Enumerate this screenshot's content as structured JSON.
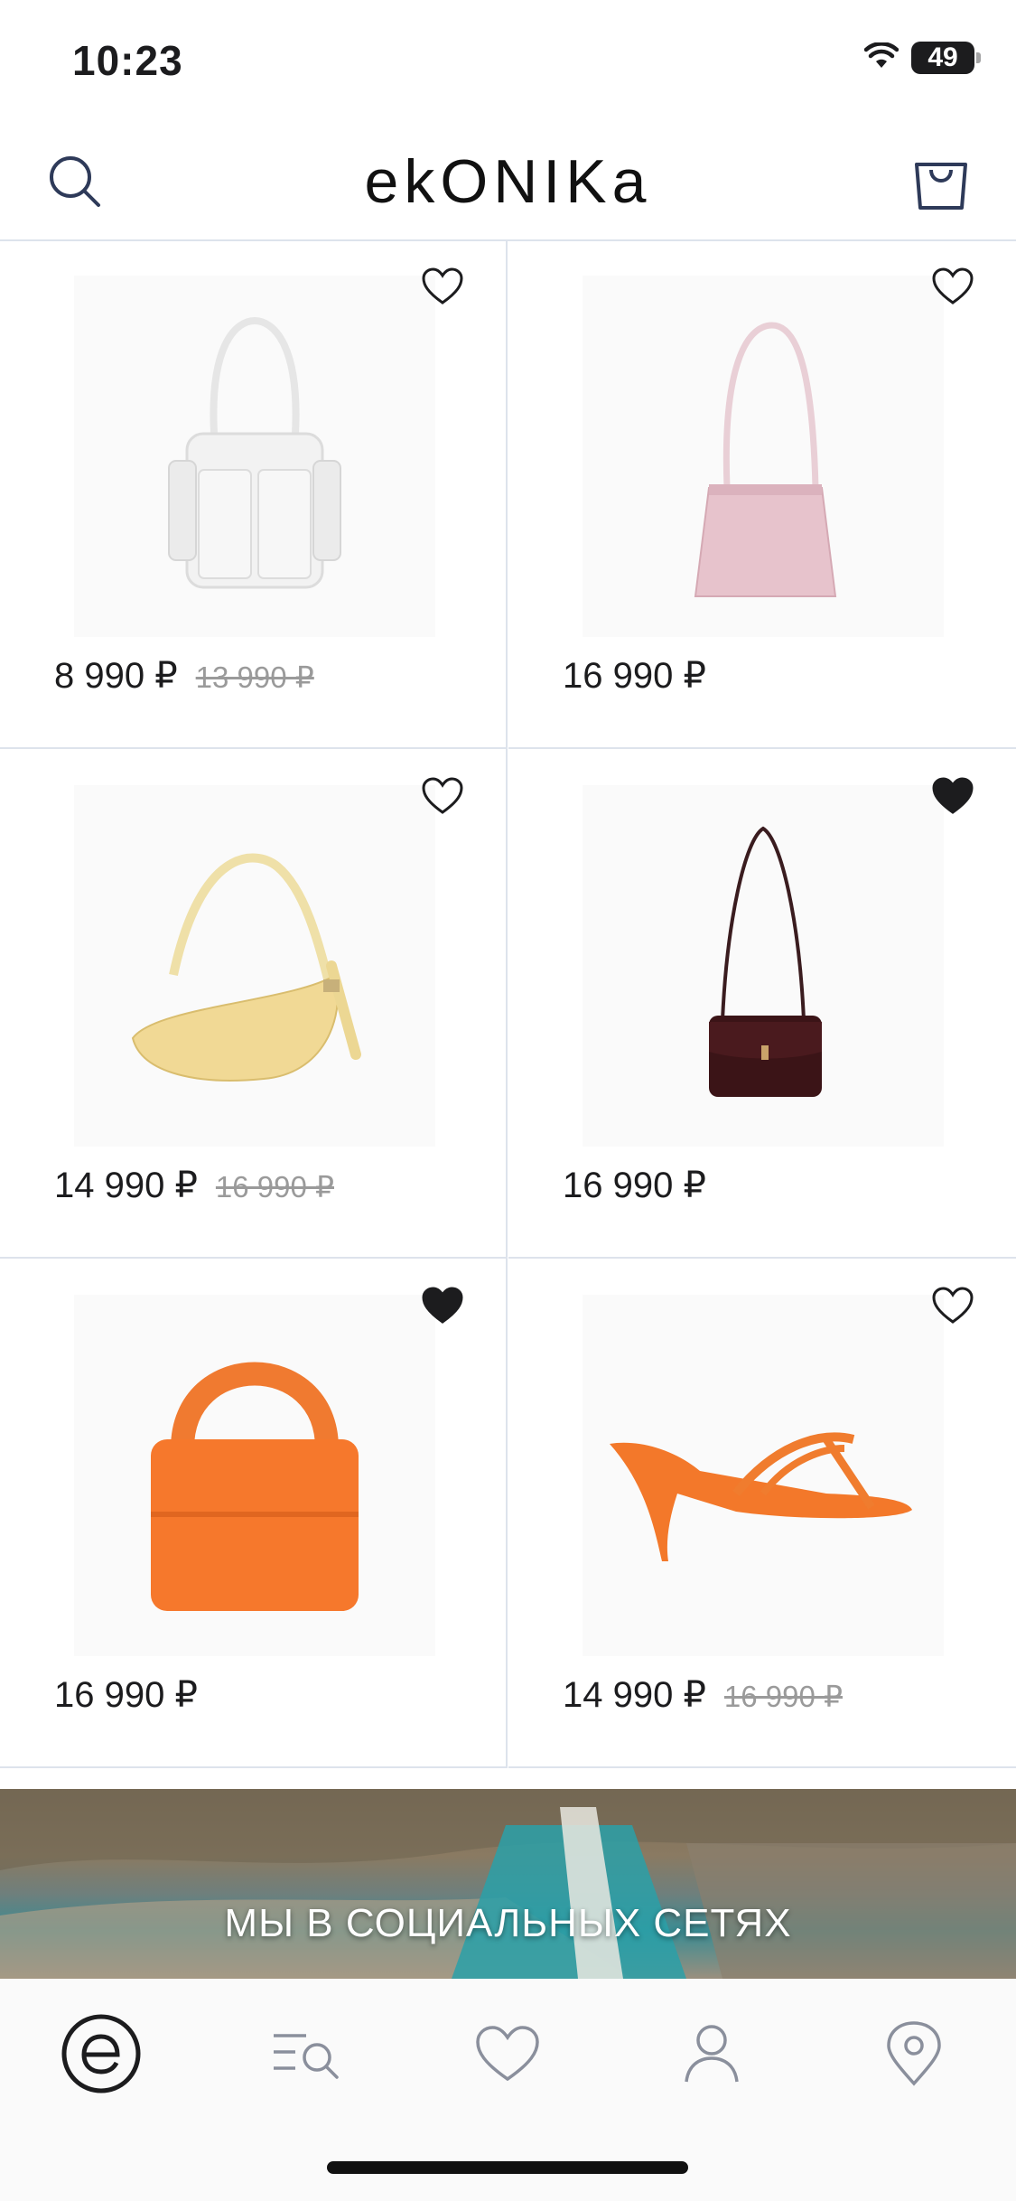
{
  "status_bar": {
    "time": "10:23",
    "battery": "49"
  },
  "header": {
    "brand": "ekONIKa",
    "search_icon": "search-icon",
    "cart_icon": "shopping-bag-icon"
  },
  "products": [
    {
      "price": "8 990 ₽",
      "old_price": "13 990 ₽",
      "favorited": false,
      "image": "white-shoulder-bag"
    },
    {
      "price": "16 990 ₽",
      "old_price": "",
      "favorited": false,
      "image": "pink-shoulder-bag"
    },
    {
      "price": "14 990 ₽",
      "old_price": "16 990 ₽",
      "favorited": false,
      "image": "yellow-baguette-bag"
    },
    {
      "price": "16 990 ₽",
      "old_price": "",
      "favorited": true,
      "image": "burgundy-crossbody-bag"
    },
    {
      "price": "16 990 ₽",
      "old_price": "",
      "favorited": true,
      "image": "orange-top-handle-bag"
    },
    {
      "price": "14 990 ₽",
      "old_price": "16 990 ₽",
      "favorited": false,
      "image": "orange-strappy-mule"
    }
  ],
  "banner": {
    "text": "МЫ В СОЦИАЛЬНЫХ СЕТЯХ"
  },
  "tabbar": {
    "items": [
      "home-logo-icon",
      "catalog-search-icon",
      "heart-icon",
      "profile-icon",
      "location-pin-icon"
    ]
  },
  "colors": {
    "accent": "#2e3a59",
    "divider": "#dde3ec",
    "text": "#1c1c1e",
    "old_price": "#9a9a9a"
  }
}
